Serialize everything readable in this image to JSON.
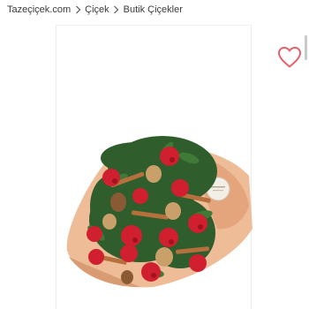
{
  "breadcrumb": {
    "items": [
      {
        "label": "Tazeçiçek.com"
      },
      {
        "label": "Çiçek"
      },
      {
        "label": "Butik Çiçekler"
      }
    ],
    "separator_icon": "chevron-right-icon"
  },
  "product": {
    "image_icon": "bouquet-image",
    "favorite_icon": "heart-outline-icon"
  },
  "colors": {
    "heart": "#e0626b",
    "wrap": "#e9b48f",
    "berry": "#d01f2e",
    "leaf": "#2f5d2b",
    "text": "#3a3a3a"
  }
}
